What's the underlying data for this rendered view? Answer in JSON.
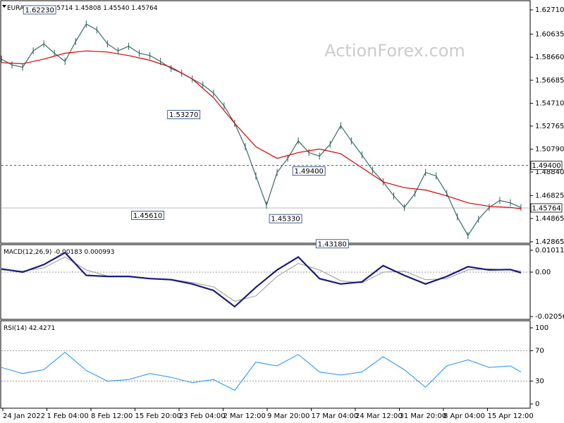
{
  "chart_data": [
    {
      "type": "line",
      "panel": "price",
      "title": "EURAUD,H4  1.45714 1.45808 1.45540 1.45764",
      "watermark": "ActionForex.com",
      "ylim": [
        1.42865,
        1.6271
      ],
      "yticks": [
        1.6271,
        1.60635,
        1.5866,
        1.56685,
        1.5471,
        1.52765,
        1.5079,
        1.4884,
        1.46825,
        1.44865,
        1.42865
      ],
      "ytick_labels": [
        "1.62710",
        "1.60635",
        "1.58660",
        "1.56685",
        "1.54710",
        "1.52765",
        "1.50790",
        "1.48840",
        "1.46825",
        "1.44865",
        "1.42865"
      ],
      "xtick_labels": [
        "24 Jan 2022",
        "1 Feb 04:00",
        "8 Feb 12:00",
        "15 Feb 20:00",
        "23 Feb 04:00",
        "2 Mar 12:00",
        "9 Mar 20:00",
        "17 Mar 04:00",
        "24 Mar 12:00",
        "31 Mar 20:00",
        "8 Apr 04:00",
        "15 Apr 12:00"
      ],
      "close_series": {
        "name": "",
        "x_index": [
          0,
          5,
          10,
          15,
          20,
          25,
          30,
          35,
          40,
          45,
          50,
          55,
          60,
          65,
          70,
          75,
          80,
          85,
          90,
          95,
          100,
          105,
          110,
          115,
          120,
          125,
          130,
          135,
          140,
          145,
          150,
          155,
          160,
          165,
          170,
          175,
          180,
          185,
          190,
          195,
          200,
          205,
          210,
          215,
          220,
          225,
          230,
          235,
          240,
          245
        ],
        "values": [
          1.585,
          1.58,
          1.578,
          1.592,
          1.598,
          1.59,
          1.583,
          1.6,
          1.615,
          1.61,
          1.598,
          1.592,
          1.596,
          1.59,
          1.588,
          1.583,
          1.577,
          1.573,
          1.568,
          1.563,
          1.556,
          1.545,
          1.53,
          1.51,
          1.485,
          1.46,
          1.488,
          1.5,
          1.515,
          1.505,
          1.502,
          1.512,
          1.528,
          1.515,
          1.503,
          1.49,
          1.48,
          1.468,
          1.458,
          1.47,
          1.488,
          1.485,
          1.47,
          1.45,
          1.434,
          1.448,
          1.458,
          1.464,
          1.462,
          1.458
        ]
      },
      "moving_average": {
        "name": "",
        "x_index": [
          0,
          10,
          20,
          30,
          40,
          50,
          60,
          70,
          80,
          90,
          100,
          110,
          120,
          130,
          140,
          150,
          160,
          170,
          180,
          190,
          200,
          210,
          220,
          230,
          240,
          245
        ],
        "values": [
          1.582,
          1.581,
          1.585,
          1.59,
          1.592,
          1.591,
          1.588,
          1.584,
          1.578,
          1.568,
          1.552,
          1.53,
          1.51,
          1.5,
          1.505,
          1.508,
          1.504,
          1.492,
          1.48,
          1.475,
          1.473,
          1.468,
          1.462,
          1.459,
          1.458,
          1.457
        ]
      },
      "levels": [
        {
          "label": "1.49400",
          "value": 1.494,
          "style": "dashed"
        },
        {
          "label": "1.45764",
          "value": 1.45764,
          "style": "solid"
        }
      ],
      "annotations": [
        {
          "label": "1.62230",
          "x_index": 18,
          "value": 1.6223
        },
        {
          "label": "1.45610",
          "x_index": 69,
          "value": 1.4561
        },
        {
          "label": "1.53270",
          "x_index": 86,
          "value": 1.5327
        },
        {
          "label": "1.45330",
          "x_index": 134,
          "value": 1.4533
        },
        {
          "label": "1.49400",
          "x_index": 145,
          "value": 1.494
        },
        {
          "label": "1.43180",
          "x_index": 156,
          "value": 1.4318
        }
      ]
    },
    {
      "type": "line",
      "panel": "macd",
      "title": "MACD(12,26,9) -0.00183 0.000993",
      "ylim": [
        -0.020561,
        0.010113
      ],
      "ytick_labels": [
        "0.010113",
        "0.00",
        "-0.020561"
      ],
      "yticks": [
        0.010113,
        0.0,
        -0.020561
      ],
      "macd": {
        "x_index": [
          0,
          10,
          20,
          30,
          40,
          50,
          60,
          70,
          80,
          90,
          100,
          110,
          120,
          130,
          140,
          150,
          160,
          170,
          180,
          190,
          200,
          210,
          220,
          230,
          240,
          245
        ],
        "values": [
          0.0015,
          0.0,
          0.0035,
          0.009,
          -0.0015,
          -0.002,
          -0.002,
          -0.003,
          -0.0035,
          -0.0055,
          -0.0085,
          -0.016,
          -0.007,
          0.001,
          0.007,
          -0.003,
          -0.0055,
          -0.0045,
          0.003,
          -0.0015,
          -0.0055,
          -0.002,
          0.0025,
          0.001,
          0.0012,
          -0.0003
        ]
      },
      "signal": {
        "x_index": [
          0,
          10,
          20,
          30,
          40,
          50,
          60,
          70,
          80,
          90,
          100,
          110,
          120,
          130,
          140,
          150,
          160,
          170,
          180,
          190,
          200,
          210,
          220,
          230,
          240,
          245
        ],
        "values": [
          0.001,
          0.0005,
          0.002,
          0.007,
          0.001,
          -0.0018,
          -0.0021,
          -0.0028,
          -0.0033,
          -0.0048,
          -0.0068,
          -0.0135,
          -0.011,
          -0.002,
          0.004,
          0.001,
          -0.004,
          -0.005,
          0.0,
          0.0005,
          -0.0035,
          -0.003,
          0.001,
          0.0015,
          0.001,
          0.0005
        ]
      }
    },
    {
      "type": "line",
      "panel": "rsi",
      "title": "RSI(14) 42.4271",
      "ylim": [
        0,
        100
      ],
      "yticks": [
        100,
        70,
        30,
        0
      ],
      "ytick_labels": [
        "100",
        "70",
        "30",
        "0"
      ],
      "rsi": {
        "x_index": [
          0,
          10,
          20,
          30,
          40,
          50,
          60,
          70,
          80,
          90,
          100,
          110,
          120,
          130,
          140,
          150,
          160,
          170,
          180,
          190,
          200,
          210,
          220,
          230,
          240,
          245
        ],
        "values": [
          48,
          40,
          45,
          68,
          44,
          30,
          32,
          40,
          35,
          28,
          32,
          18,
          55,
          50,
          65,
          42,
          38,
          42,
          62,
          45,
          22,
          50,
          58,
          48,
          50,
          42
        ]
      }
    }
  ]
}
